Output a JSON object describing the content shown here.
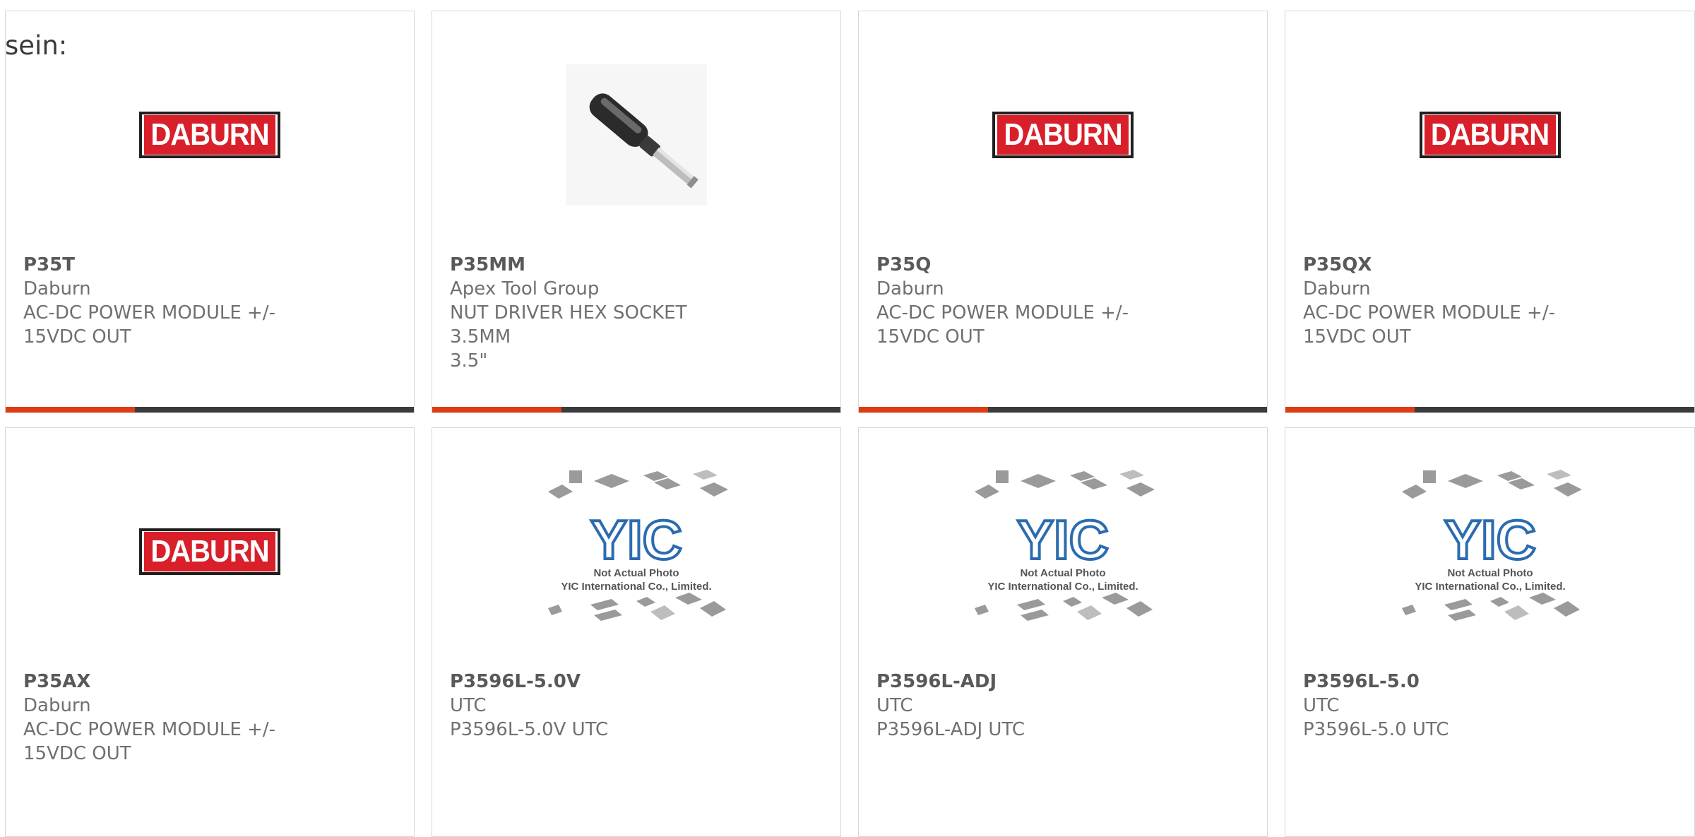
{
  "prefix_text": "sein:",
  "products": [
    {
      "part": "P35T",
      "manufacturer": "Daburn",
      "desc_line1": "AC-DC POWER MODULE +/-",
      "desc_line2": "15VDC OUT",
      "image": "daburn-logo",
      "logo_text": "DABURN"
    },
    {
      "part": "P35MM",
      "manufacturer": "Apex Tool Group",
      "desc_line1": "NUT DRIVER HEX SOCKET 3.5MM",
      "desc_line2": "3.5\"",
      "image": "nut-driver-photo"
    },
    {
      "part": "P35Q",
      "manufacturer": "Daburn",
      "desc_line1": "AC-DC POWER MODULE +/-",
      "desc_line2": "15VDC OUT",
      "image": "daburn-logo",
      "logo_text": "DABURN"
    },
    {
      "part": "P35QX",
      "manufacturer": "Daburn",
      "desc_line1": "AC-DC POWER MODULE +/-",
      "desc_line2": "15VDC OUT",
      "image": "daburn-logo",
      "logo_text": "DABURN"
    },
    {
      "part": "P35AX",
      "manufacturer": "Daburn",
      "desc_line1": "AC-DC POWER MODULE +/-",
      "desc_line2": "15VDC OUT",
      "image": "daburn-logo",
      "logo_text": "DABURN"
    },
    {
      "part": "P3596L-5.0V",
      "manufacturer": "UTC",
      "desc_line1": "P3596L-5.0V UTC",
      "desc_line2": "",
      "image": "yic-placeholder",
      "placeholder_line1": "Not Actual Photo",
      "placeholder_line2": "YIC International Co., Limited.",
      "logo_text": "YIC"
    },
    {
      "part": "P3596L-ADJ",
      "manufacturer": "UTC",
      "desc_line1": "P3596L-ADJ UTC",
      "desc_line2": "",
      "image": "yic-placeholder",
      "placeholder_line1": "Not Actual Photo",
      "placeholder_line2": "YIC International Co., Limited.",
      "logo_text": "YIC"
    },
    {
      "part": "P3596L-5.0",
      "manufacturer": "UTC",
      "desc_line1": "P3596L-5.0 UTC",
      "desc_line2": "",
      "image": "yic-placeholder",
      "placeholder_line1": "Not Actual Photo",
      "placeholder_line2": "YIC International Co., Limited.",
      "logo_text": "YIC"
    }
  ],
  "colors": {
    "accent": "#e03c12",
    "bar": "#3b3b3b",
    "border": "#d7d7d7",
    "daburn_red": "#d81f2a"
  }
}
